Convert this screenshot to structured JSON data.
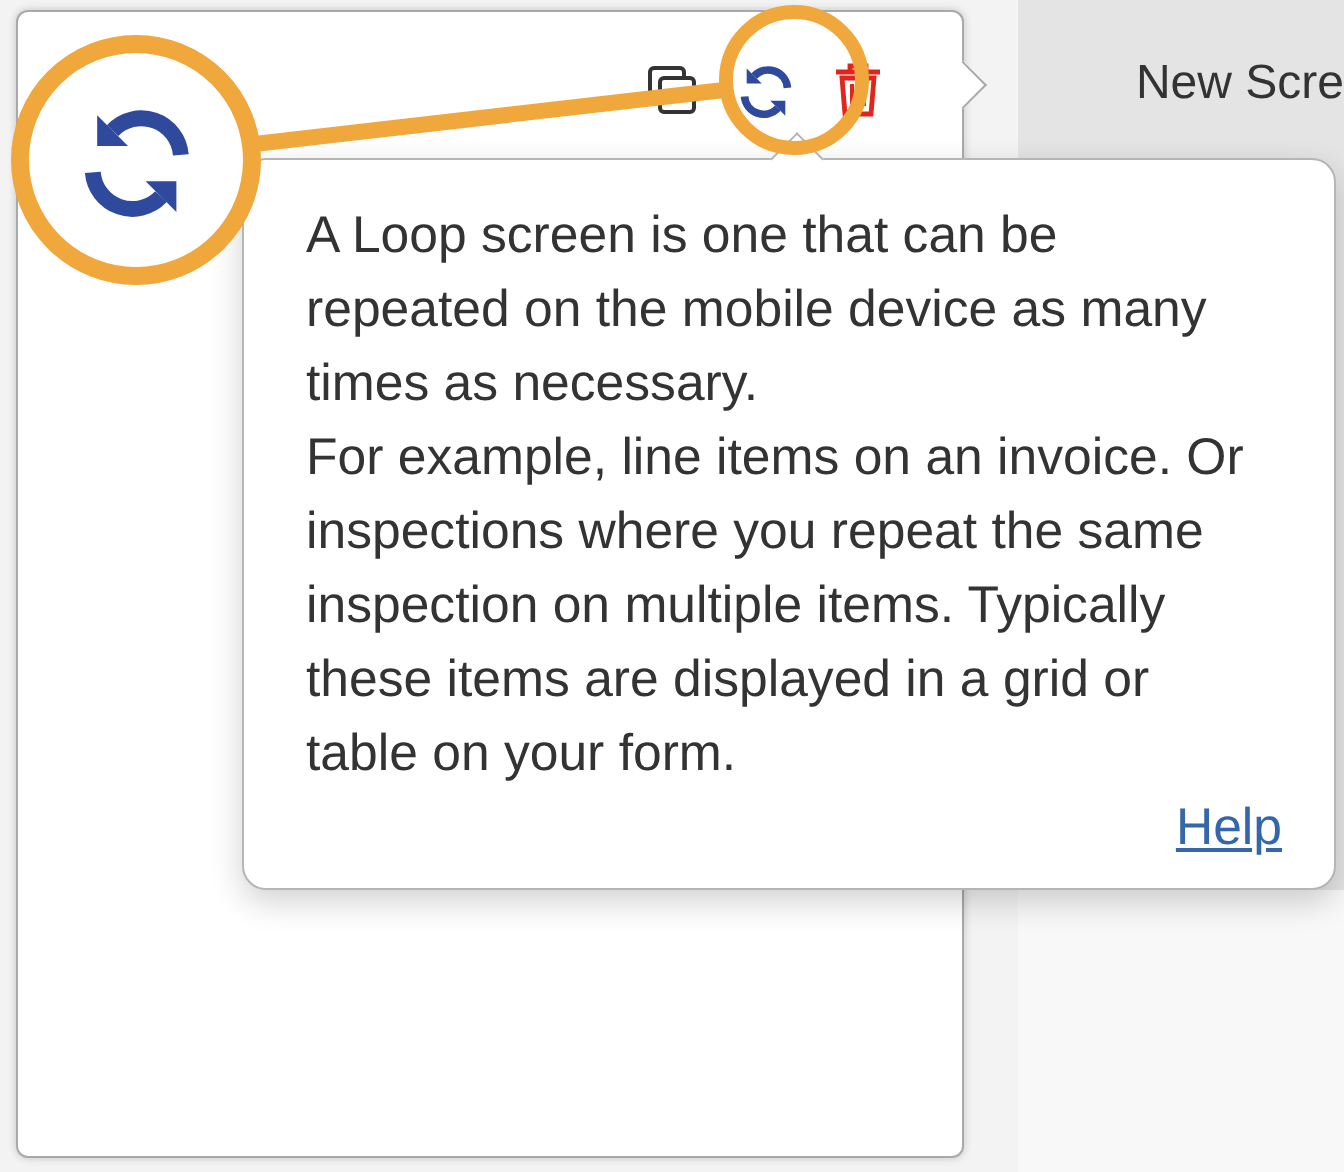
{
  "card": {
    "actions": [
      {
        "kind": "copy"
      },
      {
        "kind": "loop"
      },
      {
        "kind": "delete"
      }
    ]
  },
  "side_panel": {
    "label": "New Scre"
  },
  "tooltip": {
    "paragraphs": [
      "A Loop screen is one that can be repeated on the mobile device as many times as necessary.",
      "For example, line items on an invoice. Or inspections where you repeat the same inspection on multiple items. Typically these items are displayed in a grid or table on your form."
    ],
    "link": "Help"
  },
  "callout": {
    "kind": "loop"
  }
}
